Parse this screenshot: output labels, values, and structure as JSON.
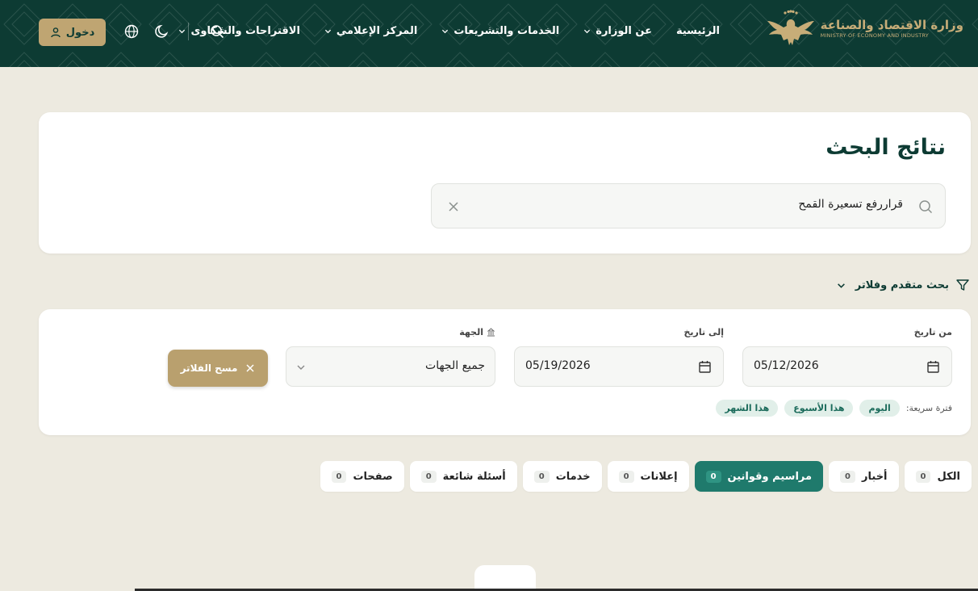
{
  "header": {
    "logo_ar": "وزارة الاقتصاد والصناعة",
    "logo_en": "MINISTRY OF ECONOMY AND INDUSTRY",
    "nav": [
      {
        "label": "الرئيسية",
        "dropdown": false
      },
      {
        "label": "عن الوزارة",
        "dropdown": true
      },
      {
        "label": "الخدمات والتشريعات",
        "dropdown": true
      },
      {
        "label": "المركز الإعلامي",
        "dropdown": true
      },
      {
        "label": "الاقتراحات والشكاوى",
        "dropdown": true
      }
    ],
    "login_label": "دخول",
    "icons": [
      "search-icon",
      "moon-icon",
      "globe-icon",
      "user-icon"
    ]
  },
  "search": {
    "title": "نتائج البحث",
    "query": "قراررفع تسعيرة القمح"
  },
  "advanced": {
    "label": "بحث متقدم وفلاتر"
  },
  "filters": {
    "from_label": "من تاريخ",
    "from_value": "05/12/2026",
    "to_label": "إلى تاريخ",
    "to_value": "05/19/2026",
    "entity_label": "الجهة",
    "entity_value": "جميع الجهات",
    "clear_label": "مسح الفلاتر",
    "quick_label": "فترة سريعة:",
    "quick_chips": [
      "اليوم",
      "هذا الأسبوع",
      "هذا الشهر"
    ]
  },
  "tabs": [
    {
      "label": "الكل",
      "count": "0",
      "active": false
    },
    {
      "label": "أخبار",
      "count": "0",
      "active": false
    },
    {
      "label": "مراسيم وقوانين",
      "count": "0",
      "active": true
    },
    {
      "label": "إعلانات",
      "count": "0",
      "active": false
    },
    {
      "label": "خدمات",
      "count": "0",
      "active": false
    },
    {
      "label": "أسئلة شائعة",
      "count": "0",
      "active": false
    },
    {
      "label": "صفحات",
      "count": "0",
      "active": false
    }
  ],
  "colors": {
    "header_bg": "#0d3b33",
    "accent_gold": "#bfa572",
    "accent_green": "#1f7a6c",
    "page_bg": "#edeae0"
  }
}
